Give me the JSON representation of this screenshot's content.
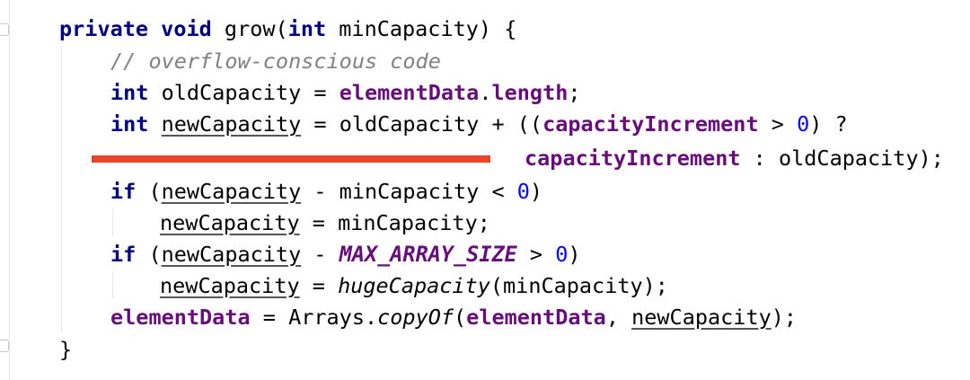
{
  "code": {
    "line1": {
      "kw": "private void",
      "rest1": " grow(",
      "kw2": "int",
      "rest2": " minCapacity) {"
    },
    "line2": {
      "comment": "// overflow-conscious code"
    },
    "line3": {
      "kw": "int",
      "rest1": " oldCapacity = ",
      "fld": "elementData",
      "dot": ".",
      "fld2": "length",
      "semi": ";"
    },
    "line4": {
      "kw": "int",
      "sp": " ",
      "var": "newCapacity",
      "rest1": " = oldCapacity + ((",
      "fld": "capacityIncrement",
      "rest2": " > ",
      "num": "0",
      "rest3": ") ?"
    },
    "line5": {
      "fld": "capacityIncrement",
      "rest": " : oldCapacity);"
    },
    "line6": {
      "kw": "if",
      "rest1": " (",
      "var": "newCapacity",
      "rest2": " - minCapacity < ",
      "num": "0",
      "rest3": ")"
    },
    "line7": {
      "var": "newCapacity",
      "rest": " = minCapacity;"
    },
    "line8": {
      "kw": "if",
      "rest1": " (",
      "var": "newCapacity",
      "rest2": " - ",
      "cst": "MAX_ARRAY_SIZE",
      "rest3": " > ",
      "num": "0",
      "rest4": ")"
    },
    "line9": {
      "var": "newCapacity",
      "rest1": " = ",
      "it": "hugeCapacity",
      "rest2": "(minCapacity);"
    },
    "line10": {
      "fld": "elementData",
      "rest1": " = Arrays.",
      "it": "copyOf",
      "rest2": "(",
      "fld2": "elementData",
      "rest3": ", ",
      "var": "newCapacity",
      "rest4": ");"
    },
    "line11": {
      "text": "}"
    }
  },
  "colors": {
    "keyword": "#000080",
    "comment": "#808080",
    "field": "#660e7a",
    "number": "#0000ff",
    "highlight_bar": "#e8432b"
  }
}
